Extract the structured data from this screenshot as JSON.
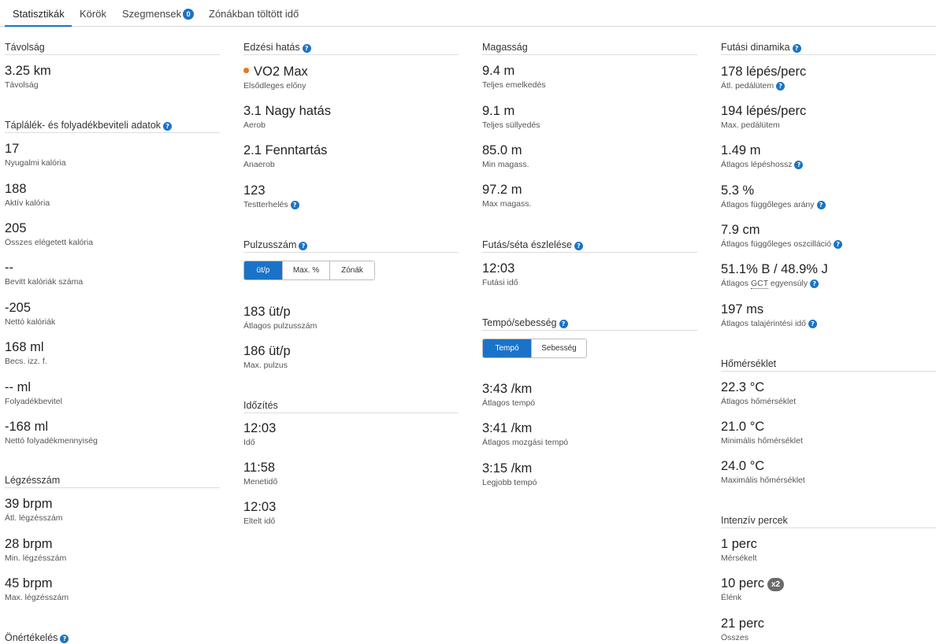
{
  "tabs": [
    {
      "label": "Statisztikák",
      "active": true
    },
    {
      "label": "Körök"
    },
    {
      "label": "Szegmensek",
      "badge": "0"
    },
    {
      "label": "Zónákban töltött idő"
    }
  ],
  "colors": {
    "accent": "#1a73c8",
    "vo2_dot": "#e87722",
    "badge_gray": "#6b6b6b"
  },
  "distance": {
    "title": "Távolság",
    "value": "3.25 km",
    "label": "Távolság"
  },
  "nutrition": {
    "title": "Táplálék- és folyadékbeviteli adatok",
    "items": [
      {
        "value": "17",
        "label": "Nyugalmi kalória"
      },
      {
        "value": "188",
        "label": "Aktív kalória"
      },
      {
        "value": "205",
        "label": "Összes elégetett kalória"
      },
      {
        "value": "--",
        "label": "Bevitt kalóriák száma"
      },
      {
        "value": "-205",
        "label": "Nettó kalóriák"
      },
      {
        "value": "168 ml",
        "label": "Becs. izz. f."
      },
      {
        "value": "-- ml",
        "label": "Folyadékbevitel"
      },
      {
        "value": "-168 ml",
        "label": "Nettó folyadékmennyiség"
      }
    ]
  },
  "respiration": {
    "title": "Légzésszám",
    "items": [
      {
        "value": "39 brpm",
        "label": "Átl. légzésszám"
      },
      {
        "value": "28 brpm",
        "label": "Min. légzésszám"
      },
      {
        "value": "45 brpm",
        "label": "Max. légzésszám"
      }
    ]
  },
  "self_eval": {
    "title": "Önértékelés"
  },
  "training_effect": {
    "title": "Edzési hatás",
    "items": [
      {
        "value": "VO2 Max",
        "label": "Elsődleges előny"
      },
      {
        "value": "3.1 Nagy hatás",
        "label": "Aerob"
      },
      {
        "value": "2.1 Fenntartás",
        "label": "Anaerob"
      },
      {
        "value": "123",
        "label": "Testterhelés"
      }
    ]
  },
  "heart_rate": {
    "title": "Pulzusszám",
    "toggle": [
      "üt/p",
      "Max. %",
      "Zónák"
    ],
    "items": [
      {
        "value": "183 üt/p",
        "label": "Átlagos pulzusszám"
      },
      {
        "value": "186 üt/p",
        "label": "Max. pulzus"
      }
    ]
  },
  "timing": {
    "title": "Időzítés",
    "items": [
      {
        "value": "12:03",
        "label": "Idő"
      },
      {
        "value": "11:58",
        "label": "Menetidő"
      },
      {
        "value": "12:03",
        "label": "Eltelt idő"
      }
    ]
  },
  "elevation": {
    "title": "Magasság",
    "items": [
      {
        "value": "9.4 m",
        "label": "Teljes emelkedés"
      },
      {
        "value": "9.1 m",
        "label": "Teljes süllyedés"
      },
      {
        "value": "85.0 m",
        "label": "Min magass."
      },
      {
        "value": "97.2 m",
        "label": "Max magass."
      }
    ]
  },
  "run_walk": {
    "title": "Futás/séta észlelése",
    "value": "12:03",
    "label": "Futási idő"
  },
  "pace": {
    "title": "Tempó/sebesség",
    "toggle": [
      "Tempó",
      "Sebesség"
    ],
    "items": [
      {
        "value": "3:43 /km",
        "label": "Átlagos tempó"
      },
      {
        "value": "3:41 /km",
        "label": "Átlagos mozgási tempó"
      },
      {
        "value": "3:15 /km",
        "label": "Legjobb tempó"
      }
    ]
  },
  "running_dynamics": {
    "title": "Futási dinamika",
    "items": [
      {
        "value": "178 lépés/perc",
        "label": "Átl. pedálütem"
      },
      {
        "value": "194 lépés/perc",
        "label": "Max. pedálütem"
      },
      {
        "value": "1.49 m",
        "label": "Átlagos lépéshossz"
      },
      {
        "value": "5.3 %",
        "label": "Átlagos függőleges arány"
      },
      {
        "value": "7.9 cm",
        "label": "Átlagos függőleges oszcilláció"
      },
      {
        "value": "51.1% B / 48.9% J",
        "label_pre": "Átlagos ",
        "label_abbr": "GCT",
        "label_post": " egyensúly"
      },
      {
        "value": "197 ms",
        "label": "Átlagos talajérintési idő"
      }
    ]
  },
  "temperature": {
    "title": "Hőmérséklet",
    "items": [
      {
        "value": "22.3 °C",
        "label": "Átlagos hőmérséklet"
      },
      {
        "value": "21.0 °C",
        "label": "Minimális hőmérséklet"
      },
      {
        "value": "24.0 °C",
        "label": "Maximális hőmérséklet"
      }
    ]
  },
  "intensity": {
    "title": "Intenzív percek",
    "items": [
      {
        "value": "1 perc",
        "label": "Mérsékelt"
      },
      {
        "value": "10 perc",
        "label": "Élénk",
        "badge": "x2"
      },
      {
        "value": "21 perc",
        "label": "Összes"
      }
    ]
  },
  "help_icon": "?"
}
